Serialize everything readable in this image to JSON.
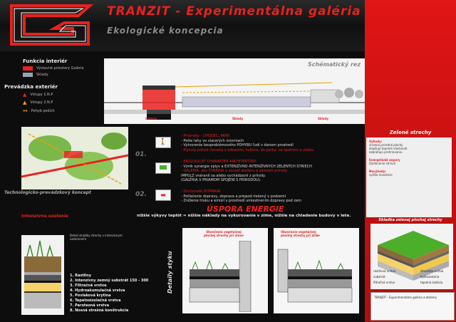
{
  "header": {
    "title": "TRANZIT - Experimentálna galéria",
    "subtitle": "Ekologické koncepcia"
  },
  "legend": {
    "interior_title": "Funkcia interiér",
    "interior_items": [
      {
        "label": "Výstavné priestory Galérie",
        "color": "#e8211f"
      },
      {
        "label": "Sklady",
        "color": "#9aa0b8"
      }
    ],
    "exterior_title": "Prevádzka exteriér",
    "exterior_items": [
      {
        "label": "Vstupy 1.N.P",
        "icon": "up-arrow-icon"
      },
      {
        "label": "Vstupy 2.N.P",
        "icon": "triangle-icon"
      },
      {
        "label": "Pohyb peších",
        "icon": "double-arrow-icon"
      }
    ]
  },
  "section": {
    "title": "Schématický rez",
    "labels": [
      "Galéria",
      "Sklady",
      "Sklady"
    ]
  },
  "map_caption": "Technologicko-prevádzkový koncept",
  "concepts": [
    {
      "num": "01.",
      "lines": [
        "- Prvorady - CHODEC, PARK",
        "- Pešie lahy vo viacerých úrovniach",
        "- Vytvorenie bezproblémového POHYBU ľudí v danom prostredí",
        "- Plynulý pohyb človeka s odkazom, kultúra, do parku, za športom a vodou"
      ]
    },
    {
      "num": "",
      "lines": [
        "- EKOLOGICKÝ CHARAKTER ARCHITEKTÚRY",
        "- Vznik synergie vplyv a EXTENZÍVNO-INTENZÍVNYCH ZELENÝCH STRIECH",
        "- GALÉRIA: ako ŠTRBINA a súčasť ateliéru a zároveň prírody.",
        "  IMPULZ vnáraníi sa alebo vychádzanií z prírody.",
        "  (GALÉRIA V PRIAMOM SPOJENÍ S PRÍRODOU)."
      ]
    },
    {
      "num": "02.",
      "lines": [
        "- Druhoradá DOPRAVA",
        "- Potlačenie dopravy, doprava a prejazd riešený v podzemí",
        "- Zníženie hluku a emisií v prostredí umiestnením dopravy pod zem"
      ]
    }
  ],
  "spora": {
    "title": "ÚSPORA ENERGIE",
    "line": "nižšie výkyvy teplôt = nižšie náklady na vykurovanie v zime, nižšie na chladenie budovy v lete."
  },
  "green_roof": {
    "title": "Intenzívne ozelenie",
    "detail_caption": "Detail skladby strechy s intenzívnym ozelenením",
    "layers": [
      "1. Rastliny",
      "2. Intenzívny zemný substrát 150 - 300",
      "3. Filtračná vrstva",
      "4. Hydroakumulačná vrstva",
      "5. Povlaková krytina",
      "6. Tepelnoizolačná vrstva",
      "7. Parotesná vrstva",
      "8. Nosná strešná konštrukcia"
    ]
  },
  "details": {
    "label": "Detaily styku",
    "box1_caption": "Ukončenie vegetačnej plochej strechy pri stene",
    "box2_caption": "Ukončenie vegetačnej plochej strechy pri atike"
  },
  "right_column": {
    "title": "Zelené strechy",
    "items": [
      "Výhody:",
      "chránia prírodné plochy",
      "zlepšujú tepelné vlastnosti",
      "zabraňujú prehrievaniu",
      "Energetické úspory",
      "Ozelenenie striech",
      "Nevýhody:",
      "vyššie investície"
    ],
    "diagram_title": "Skladba zelenej plochej strechy",
    "diagram_labels": [
      "rastlinná vrstva",
      "substrát",
      "filtračná vrstva",
      "drenážna vrstva",
      "hydroizolácia",
      "tepelná izolácia"
    ],
    "titleblock": "TRANZIT - Experimentálna galéria a ateliéry"
  },
  "colors": {
    "accent_red": "#e8211f",
    "background": "#0d0d0d"
  }
}
